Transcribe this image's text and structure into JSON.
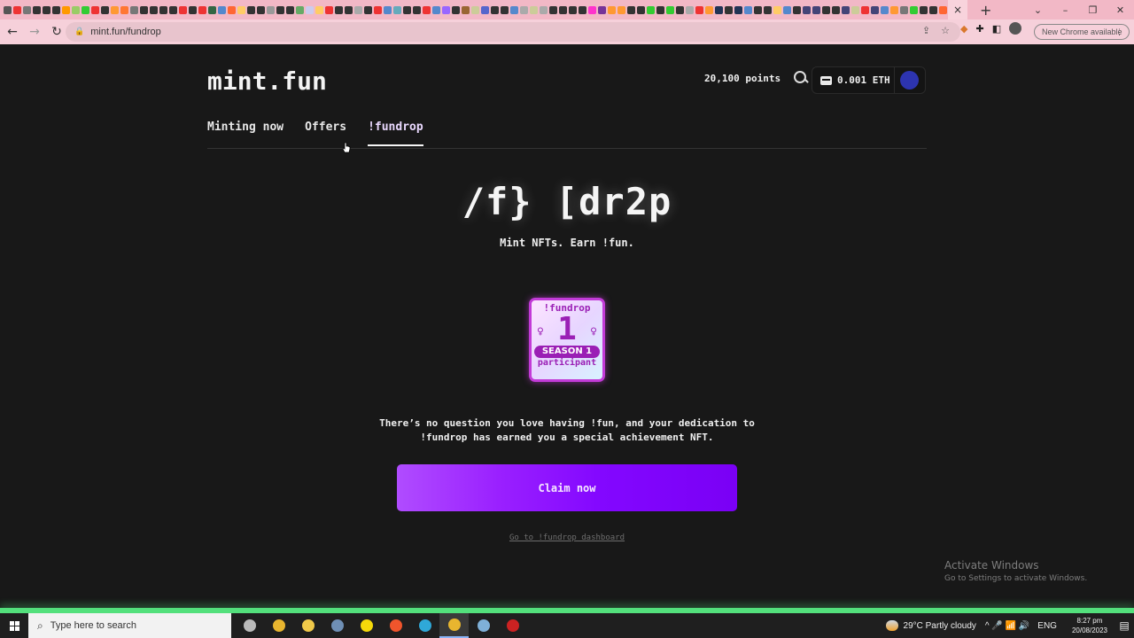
{
  "browser": {
    "url": "mint.fun/fundrop",
    "new_tab_label": "+",
    "active_tab_close": "×",
    "update_label": "New Chrome available",
    "window_controls": {
      "list": "⌄",
      "minimize": "–",
      "maximize": "❐",
      "close": "✕"
    },
    "tab_favicon_colors": [
      "#555",
      "#e33",
      "#777",
      "#333",
      "#333",
      "#333",
      "#f90",
      "#9c6",
      "#3c3",
      "#e33",
      "#333",
      "#f93",
      "#f73",
      "#777",
      "#333",
      "#333",
      "#333",
      "#333",
      "#e33",
      "#333",
      "#e33",
      "#364",
      "#58c",
      "#f63",
      "#fc6",
      "#333",
      "#333",
      "#999",
      "#333",
      "#333",
      "#6a6",
      "#cce",
      "#fc6",
      "#e33",
      "#333",
      "#333",
      "#aaa",
      "#333",
      "#e33",
      "#58c",
      "#6ab",
      "#333",
      "#333",
      "#e33",
      "#58c",
      "#96f",
      "#333",
      "#963",
      "#cc9",
      "#56c",
      "#333",
      "#333",
      "#58c",
      "#aaa",
      "#cc9",
      "#aaa",
      "#333",
      "#333",
      "#333",
      "#333",
      "#f3c",
      "#739",
      "#f93",
      "#f93",
      "#333",
      "#333",
      "#3c3",
      "#333",
      "#3c3",
      "#333",
      "#aaa",
      "#e33",
      "#f93",
      "#235",
      "#333",
      "#235",
      "#58c",
      "#333",
      "#333",
      "#fc6",
      "#58c",
      "#333",
      "#447",
      "#447",
      "#333",
      "#333",
      "#447",
      "#cc9",
      "#e33",
      "#447",
      "#58c",
      "#f93",
      "#777",
      "#3c3",
      "#333",
      "#333",
      "#f63"
    ]
  },
  "site": {
    "logo": "mint.fun",
    "points": "20,100 points",
    "wallet_balance": "0.001 ETH",
    "avatar_color": "#2d34b0",
    "nav": [
      {
        "label": "Minting now",
        "active": false
      },
      {
        "label": "Offers",
        "active": false
      },
      {
        "label": "!fundrop",
        "active": true
      }
    ]
  },
  "hero": {
    "title": "/f} [dr2p",
    "subtitle": "Mint NFTs. Earn !fun."
  },
  "badge": {
    "top": "!fundrop",
    "number": "1",
    "season": "SEASON 1",
    "bottom": "participant",
    "accent": "#9a1fb5"
  },
  "description": {
    "line1": "There’s no question you love having !fun, and your dedication to",
    "line2": "!fundrop has earned you a special achievement NFT."
  },
  "actions": {
    "claim_label": "Claim now",
    "dashboard_link": "Go to !fundrop dashboard"
  },
  "watermark": {
    "title": "Activate Windows",
    "subtitle": "Go to Settings to activate Windows."
  },
  "taskbar": {
    "search_placeholder": "Type here to search",
    "apps": [
      {
        "name": "task-view",
        "color": "#bbbbbb",
        "active": false
      },
      {
        "name": "chrome",
        "color": "#e8b52f",
        "active": false
      },
      {
        "name": "file-explorer",
        "color": "#f0c94a",
        "active": false
      },
      {
        "name": "calculator",
        "color": "#6f8fb5",
        "active": false
      },
      {
        "name": "sticky-notes",
        "color": "#f5d90a",
        "active": false
      },
      {
        "name": "brave",
        "color": "#f0552c",
        "active": false
      },
      {
        "name": "edge",
        "color": "#2fa8d8",
        "active": false
      },
      {
        "name": "chrome-active",
        "color": "#e8b52f",
        "active": true
      },
      {
        "name": "notepad",
        "color": "#7fb0d8",
        "active": false
      },
      {
        "name": "obs",
        "color": "#c22",
        "active": false
      }
    ],
    "weather": "29°C  Partly cloudy",
    "tray_icons": "^  🎤  📶  🔊",
    "language": "ENG",
    "time": "8:27 pm",
    "date": "20/08/2023"
  }
}
